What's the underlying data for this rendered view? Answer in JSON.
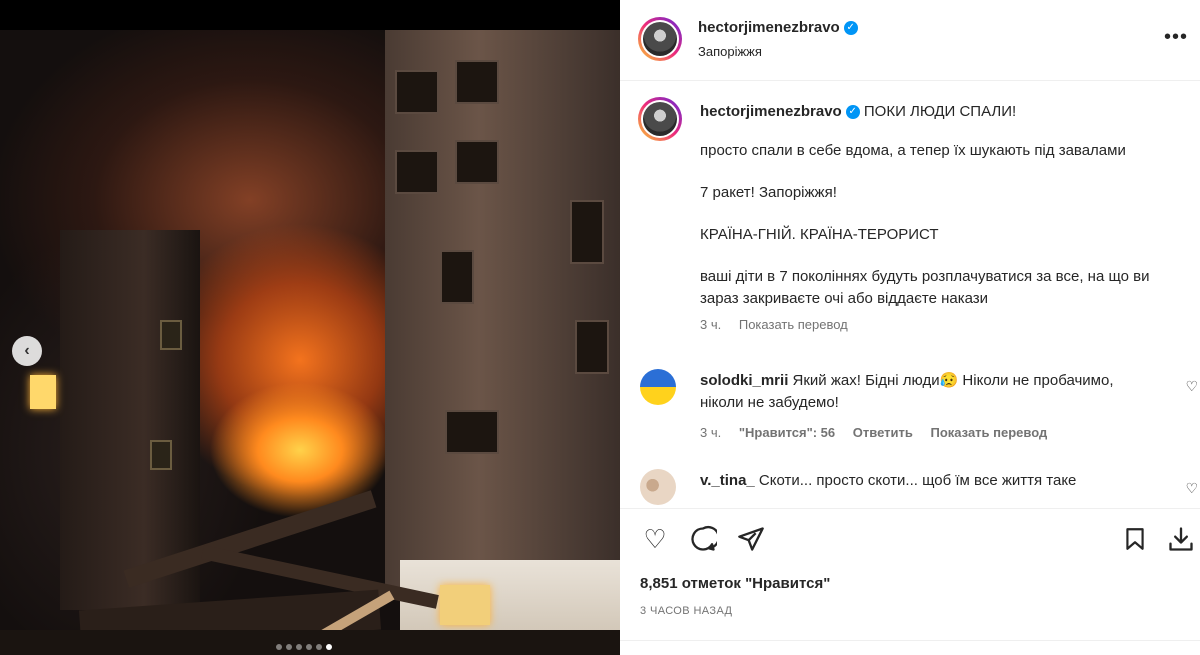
{
  "post": {
    "username": "hectorjimenezbravo",
    "location": "Запоріжжя",
    "more_icon": "more-horizontal-icon"
  },
  "caption": {
    "username": "hectorjimenezbravo",
    "lines": [
      "ПОКИ ЛЮДИ СПАЛИ!",
      "просто спали в себе вдома, а тепер їх шукають під завалами",
      "7 ракет! Запоріжжя!",
      "КРАЇНА-ГНІЙ. КРАЇНА-ТЕРОРИСТ",
      "ваші діти в 7 поколіннях будуть розплачуватися за все, на що ви зараз закриваєте очі або віддаєте накази"
    ],
    "time": "3 ч.",
    "translate": "Показать перевод"
  },
  "comments": [
    {
      "username": "solodki_mrii",
      "text": "Який жах! Бідні люди😥 Ніколи не пробачимо, ніколи не забудемо!",
      "time": "3 ч.",
      "likes": "\"Нравится\": 56",
      "reply": "Ответить",
      "translate": "Показать перевод"
    },
    {
      "username": "v._tina_",
      "text": "Скоти... просто скоти... щоб їм все життя таке"
    }
  ],
  "footer": {
    "likes": "8,851 отметок \"Нравится\"",
    "time": "3 ЧАСОВ НАЗАД"
  },
  "carousel": {
    "total": 6,
    "active_index": 5
  },
  "colors": {
    "verified": "#0095f6",
    "text": "#262626",
    "muted": "#737373"
  }
}
